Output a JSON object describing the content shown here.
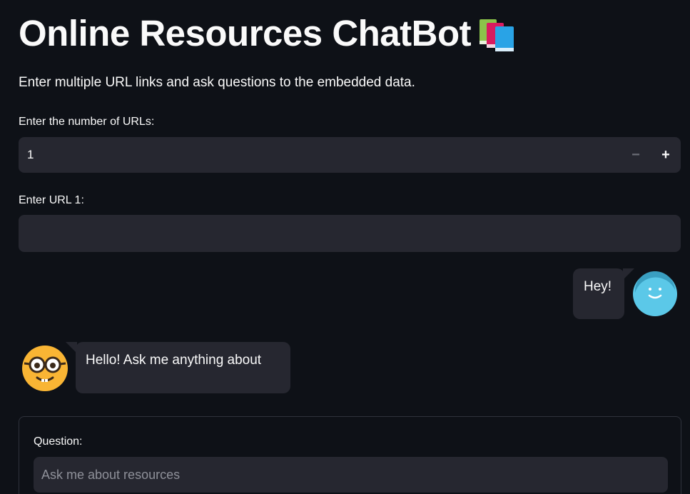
{
  "header": {
    "title": "Online Resources ChatBot",
    "title_icon": "books-icon"
  },
  "subtitle": "Enter multiple URL links and ask questions to the embedded data.",
  "num_urls": {
    "label": "Enter the number of URLs:",
    "value": "1",
    "decrement_label": "−",
    "increment_label": "+"
  },
  "url_inputs": [
    {
      "label": "Enter URL 1:",
      "value": ""
    }
  ],
  "chat": {
    "messages": [
      {
        "role": "user",
        "text": "Hey!",
        "avatar": "smiley-avatar-icon"
      },
      {
        "role": "assistant",
        "text": "Hello! Ask me anything about",
        "avatar": "nerd-face-avatar-icon"
      }
    ]
  },
  "form": {
    "question_label": "Question:",
    "question_placeholder": "Ask me about resources",
    "question_value": ""
  },
  "colors": {
    "background": "#0e1117",
    "input_bg": "#262730",
    "text": "#fafafa",
    "user_avatar": "#5bc8e8",
    "bot_avatar": "#f9b534"
  }
}
